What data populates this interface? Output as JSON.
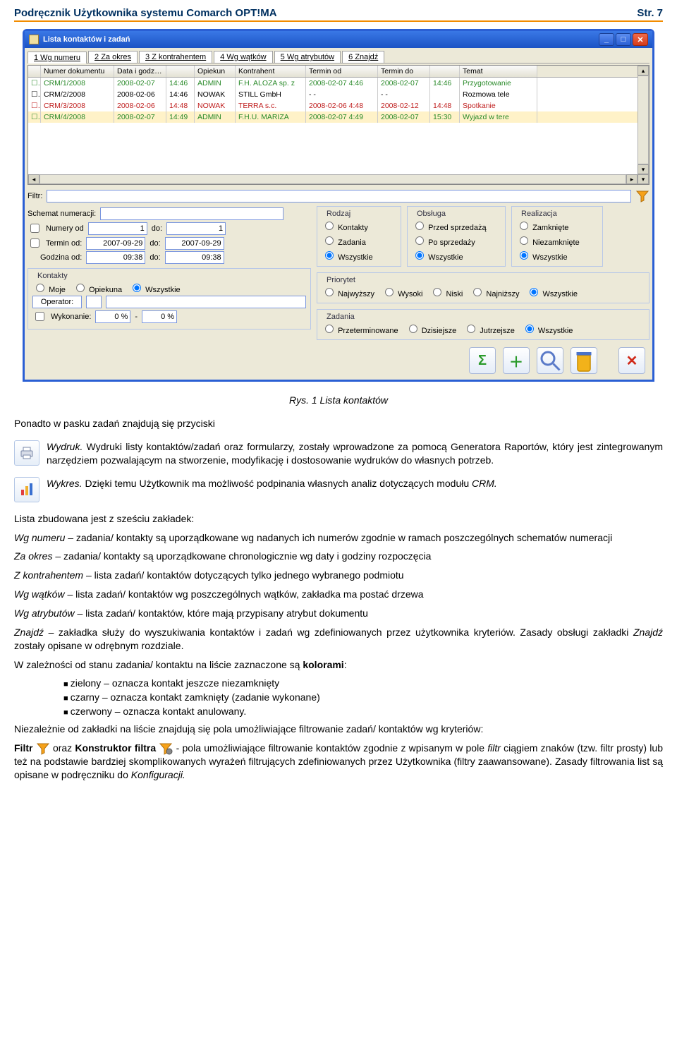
{
  "header": {
    "title": "Podręcznik Użytkownika systemu Comarch OPT!MA",
    "page": "Str. 7"
  },
  "window": {
    "title": "Lista kontaktów i zadań",
    "tabs": [
      "1 Wg numeru",
      "2 Za okres",
      "3 Z kontrahentem",
      "4 Wg wątków",
      "5 Wg atrybutów",
      "6 Znajdź"
    ],
    "columns": [
      "",
      "Numer dokumentu",
      "Data i godzina",
      "",
      "Opiekun",
      "Kontrahent",
      "Termin od",
      "Termin do",
      "",
      "Temat"
    ],
    "rows": [
      {
        "num": "CRM/1/2008",
        "date": "2008-02-07",
        "time": "14:46",
        "op": "ADMIN",
        "ko": "F.H. ALOZA sp. z",
        "tod": "2008-02-07  4:46",
        "tdd": "2008-02-07",
        "tdt": "14:46",
        "tm": "Przygotowanie"
      },
      {
        "num": "CRM/2/2008",
        "date": "2008-02-06",
        "time": "14:46",
        "op": "NOWAK",
        "ko": "STILL GmbH",
        "tod": "- -",
        "tdd": "- -",
        "tdt": "",
        "tm": "Rozmowa tele"
      },
      {
        "num": "CRM/3/2008",
        "date": "2008-02-06",
        "time": "14:48",
        "op": "NOWAK",
        "ko": "TERRA s.c.",
        "tod": "2008-02-06  4:48",
        "tdd": "2008-02-12",
        "tdt": "14:48",
        "tm": "Spotkanie"
      },
      {
        "num": "CRM/4/2008",
        "date": "2008-02-07",
        "time": "14:49",
        "op": "ADMIN",
        "ko": "F.H.U. MARIZA",
        "tod": "2008-02-07  4:49",
        "tdd": "2008-02-07",
        "tdt": "15:30",
        "tm": "Wyjazd w tere"
      }
    ],
    "filter_label": "Filtr:",
    "schema_label": "Schemat numeracji:",
    "numery_label": "Numery od",
    "termin_label": "Termin od:",
    "godzina_label": "Godzina od:",
    "do_label": "do:",
    "num_from": "1",
    "num_to": "1",
    "date_from": "2007-09-29",
    "date_to": "2007-09-29",
    "time_from": "09:38",
    "time_to": "09:38",
    "rodzaj": {
      "title": "Rodzaj",
      "o1": "Kontakty",
      "o2": "Zadania",
      "o3": "Wszystkie"
    },
    "obsluga": {
      "title": "Obsługa",
      "o1": "Przed sprzedażą",
      "o2": "Po sprzedaży",
      "o3": "Wszystkie"
    },
    "realizacja": {
      "title": "Realizacja",
      "o1": "Zamknięte",
      "o2": "Niezamknięte",
      "o3": "Wszystkie"
    },
    "kontakty": {
      "title": "Kontakty",
      "o1": "Moje",
      "o2": "Opiekuna",
      "o3": "Wszystkie",
      "operator": "Operator:",
      "wyk": "Wykonanie:",
      "wyk_from": "0 %",
      "wyk_to": "0 %"
    },
    "priorytet": {
      "title": "Priorytet",
      "o1": "Najwyższy",
      "o2": "Wysoki",
      "o3": "Niski",
      "o4": "Najniższy",
      "o5": "Wszystkie"
    },
    "zadania": {
      "title": "Zadania",
      "o1": "Przeterminowane",
      "o2": "Dzisiejsze",
      "o3": "Jutrzejsze",
      "o4": "Wszystkie"
    }
  },
  "caption": "Rys. 1 Lista kontaktów",
  "body": {
    "p1": "Ponadto w pasku zadań znajdują się przyciski",
    "wydruk_title": "Wydruk.",
    "wydruk_text": " Wydruki listy kontaktów/zadań oraz formularzy, zostały wprowadzone za pomocą Generatora Raportów, który jest zintegrowanym narzędziem pozwalającym na stworzenie, modyfikację i dostosowanie wydruków do własnych potrzeb.",
    "wykres_title": "Wykres.",
    "wykres_text": " Dzięki temu Użytkownik ma możliwość podpinania własnych analiz dotyczących modułu ",
    "wykres_em": "CRM.",
    "p_list_intro": "Lista zbudowana jest z sześciu zakładek:",
    "li1a": "Wg numeru",
    "li1b": " – zadania/ kontakty są uporządkowane wg nadanych ich numerów zgodnie w ramach poszczególnych schematów numeracji",
    "li2a": "Za okres",
    "li2b": " – zadania/ kontakty są uporządkowane chronologicznie wg daty i godziny rozpoczęcia",
    "li3a": "Z kontrahentem",
    "li3b": " – lista zadań/ kontaktów dotyczących tylko jednego wybranego podmiotu",
    "li4a": "Wg wątków",
    "li4b": " – lista zadań/ kontaktów wg poszczególnych wątków, zakładka ma postać drzewa",
    "li5a": "Wg atrybutów",
    "li5b": " – lista zadań/ kontaktów, które mają przypisany atrybut dokumentu",
    "li6a": "Znajdź",
    "li6b": " – zakładka służy do wyszukiwania kontaktów i zadań wg zdefiniowanych przez użytkownika kryteriów. Zasady obsługi zakładki ",
    "li6c": "Znajdź",
    "li6d": " zostały opisane w odrębnym rozdziale.",
    "colors_intro_a": "W zależności od stanu zadania/ kontaktu na liście zaznaczone są ",
    "colors_intro_b": "kolorami",
    "colors_intro_c": ":",
    "c1": "zielony – oznacza kontakt jeszcze niezamknięty",
    "c2": "czarny – oznacza kontakt zamknięty (zadanie wykonane)",
    "c3": "czerwony – oznacza kontakt anulowany.",
    "p_filter_intro": "Niezależnie od zakładki na liście znajdują się pola umożliwiające filtrowanie zadań/ kontaktów wg kryteriów:",
    "f_label1": "Filtr ",
    "f_mid": " oraz ",
    "f_label2": "Konstruktor filtra ",
    "f_text": " - pola umożliwiające filtrowanie kontaktów zgodnie z wpisanym w pole ",
    "f_em": "filtr",
    "f_text2": " ciągiem znaków (tzw. filtr prosty) lub też na podstawie bardziej skomplikowanych wyrażeń filtrujących zdefiniowanych przez Użytkownika (filtry zaawansowane). Zasady filtrowania list są opisane w podręczniku do ",
    "f_em2": "Konfiguracji."
  }
}
